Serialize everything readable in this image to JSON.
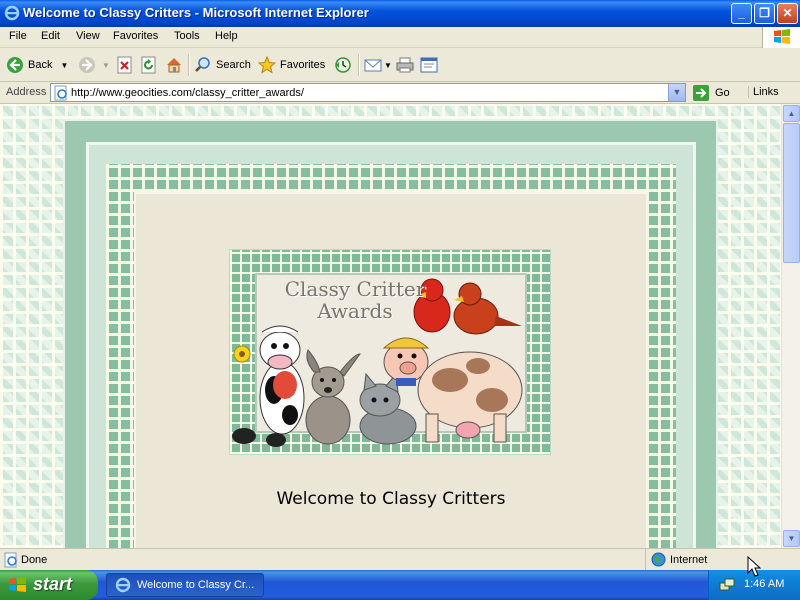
{
  "window": {
    "title": "Welcome to Classy Critters - Microsoft Internet Explorer",
    "minimize": "_",
    "maximize": "❐",
    "close": "✕"
  },
  "menu": {
    "items": [
      "File",
      "Edit",
      "View",
      "Favorites",
      "Tools",
      "Help"
    ]
  },
  "toolbar": {
    "back_label": "Back",
    "search_label": "Search",
    "favorites_label": "Favorites"
  },
  "address": {
    "label": "Address",
    "url": "http://www.geocities.com/classy_critter_awards/",
    "go_label": "Go",
    "links_label": "Links"
  },
  "page": {
    "banner_title_line1": "Classy Critter",
    "banner_title_line2": "Awards",
    "welcome_text": "Welcome to Classy Critters"
  },
  "status": {
    "text": "Done",
    "zone": "Internet"
  },
  "taskbar": {
    "start_label": "start",
    "task_label": "Welcome to Classy Cr...",
    "clock": "1:46 AM"
  },
  "colors": {
    "title_bar": "#0453dc",
    "chrome": "#ece9d8",
    "tile_green": "#7fb79a",
    "page_beige": "#ebe6d6",
    "start_green": "#3b9a3b"
  }
}
